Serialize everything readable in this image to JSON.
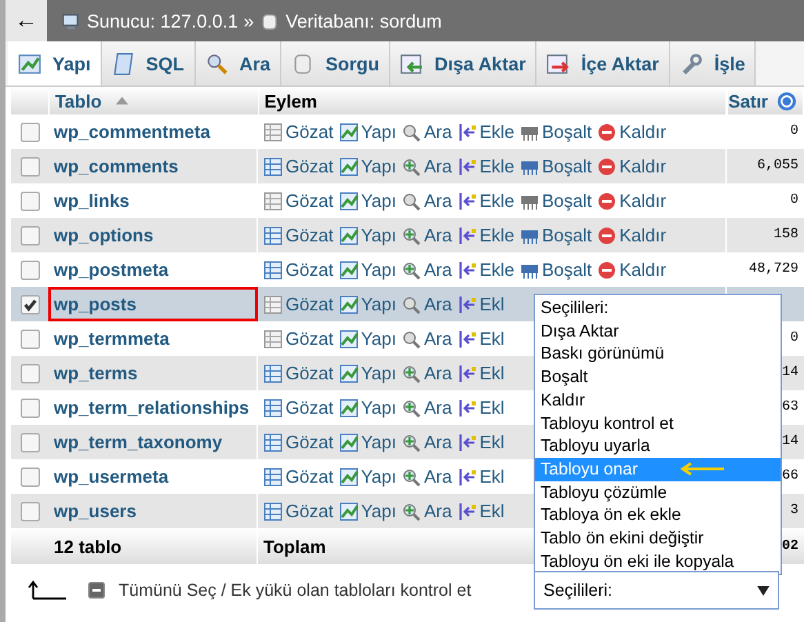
{
  "breadcrumb": {
    "back": "←",
    "server": "Sunucu: 127.0.0.1",
    "separator": "»",
    "database": "Veritabanı: sordum"
  },
  "tabs": [
    {
      "label": "Yapı",
      "selected": true
    },
    {
      "label": "SQL",
      "selected": false
    },
    {
      "label": "Ara",
      "selected": false
    },
    {
      "label": "Sorgu",
      "selected": false
    },
    {
      "label": "Dışa Aktar",
      "selected": false
    },
    {
      "label": "İçe Aktar",
      "selected": false
    },
    {
      "label": "İşle",
      "selected": false
    }
  ],
  "table": {
    "columns": [
      "Tablo",
      "Eylem",
      "Satır"
    ],
    "rows": [
      {
        "name": "wp_commentmeta",
        "checked": false,
        "highlighted": false,
        "empty": true,
        "actions": [
          "Gözat",
          "Yapı",
          "Ara",
          "Ekle",
          "Boşalt",
          "Kaldır"
        ],
        "rows": "0"
      },
      {
        "name": "wp_comments",
        "checked": false,
        "highlighted": false,
        "empty": false,
        "actions": [
          "Gözat",
          "Yapı",
          "Ara",
          "Ekle",
          "Boşalt",
          "Kaldır"
        ],
        "rows": "6,055"
      },
      {
        "name": "wp_links",
        "checked": false,
        "highlighted": false,
        "empty": true,
        "actions": [
          "Gözat",
          "Yapı",
          "Ara",
          "Ekle",
          "Boşalt",
          "Kaldır"
        ],
        "rows": "0"
      },
      {
        "name": "wp_options",
        "checked": false,
        "highlighted": false,
        "empty": false,
        "actions": [
          "Gözat",
          "Yapı",
          "Ara",
          "Ekle",
          "Boşalt",
          "Kaldır"
        ],
        "rows": "158"
      },
      {
        "name": "wp_postmeta",
        "checked": false,
        "highlighted": false,
        "empty": false,
        "actions": [
          "Gözat",
          "Yapı",
          "Ara",
          "Ekle",
          "Boşalt",
          "Kaldır"
        ],
        "rows": "48,729"
      },
      {
        "name": "wp_posts",
        "checked": true,
        "highlighted": true,
        "empty": true,
        "actions": [
          "Gözat",
          "Yapı",
          "Ara",
          "Ekl"
        ]
      },
      {
        "name": "wp_termmeta",
        "checked": false,
        "highlighted": false,
        "empty": true,
        "actions": [
          "Gözat",
          "Yapı",
          "Ara",
          "Ekl"
        ],
        "rows": "0"
      },
      {
        "name": "wp_terms",
        "checked": false,
        "highlighted": false,
        "empty": false,
        "actions": [
          "Gözat",
          "Yapı",
          "Ara",
          "Ekl"
        ],
        "rows": "14"
      },
      {
        "name": "wp_term_relationships",
        "checked": false,
        "highlighted": false,
        "empty": false,
        "actions": [
          "Gözat",
          "Yapı",
          "Ara",
          "Ekl"
        ],
        "rows": "63"
      },
      {
        "name": "wp_term_taxonomy",
        "checked": false,
        "highlighted": false,
        "empty": false,
        "actions": [
          "Gözat",
          "Yapı",
          "Ara",
          "Ekl"
        ],
        "rows": "14"
      },
      {
        "name": "wp_usermeta",
        "checked": false,
        "highlighted": false,
        "empty": false,
        "actions": [
          "Gözat",
          "Yapı",
          "Ara",
          "Ekl"
        ],
        "rows": "66"
      },
      {
        "name": "wp_users",
        "checked": false,
        "highlighted": false,
        "empty": false,
        "actions": [
          "Gözat",
          "Yapı",
          "Ara",
          "Ekl"
        ],
        "rows": "3"
      }
    ],
    "footer": {
      "count": "12 tablo",
      "label": "Toplam",
      "total": "02"
    }
  },
  "bulk": {
    "select_all_indeterminate": true,
    "select_all": "Tümünü Seç / Ek yükü olan tabloları kontrol et",
    "select_value": "Seçilileri:",
    "options": [
      {
        "label": "Seçilileri:",
        "selected": false
      },
      {
        "label": "Dışa Aktar",
        "selected": false
      },
      {
        "label": "Baskı görünümü",
        "selected": false
      },
      {
        "label": "Boşalt",
        "selected": false
      },
      {
        "label": "Kaldır",
        "selected": false
      },
      {
        "label": "Tabloyu kontrol et",
        "selected": false
      },
      {
        "label": "Tabloyu uyarla",
        "selected": false
      },
      {
        "label": "Tabloyu onar",
        "selected": true,
        "pointer": true
      },
      {
        "label": "Tabloyu çözümle",
        "selected": false
      },
      {
        "label": "Tabloya ön ek ekle",
        "selected": false
      },
      {
        "label": "Tablo ön ekini değiştir",
        "selected": false
      },
      {
        "label": "Tabloyu ön eki ile kopyala",
        "selected": false
      }
    ]
  }
}
